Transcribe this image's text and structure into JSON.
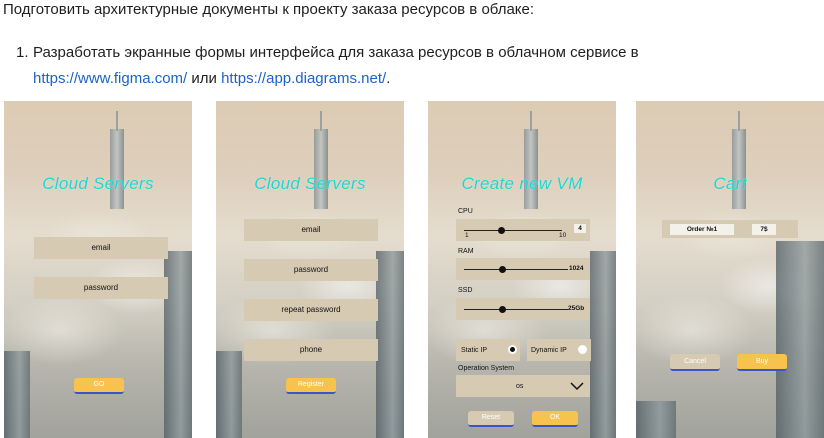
{
  "intro": "Подготовить архитектурные документы к проекту заказа ресурсов в облаке:",
  "task": {
    "number": "1.",
    "text_before": "Разработать экранные формы интерфейса для заказа ресурсов в облачном сервисе в",
    "link1": "https://www.figma.com/",
    "middle": " или ",
    "link2": "https://app.diagrams.net/",
    "end": "."
  },
  "screens": {
    "login": {
      "title": "Cloud Servers",
      "email": "email",
      "password": "password",
      "button": "GO"
    },
    "register": {
      "title": "Cloud Servers",
      "email": "email",
      "password": "password",
      "repeat_password": "repeat password",
      "phone": "phone",
      "button": "Register"
    },
    "create_vm": {
      "title": "Create new VM",
      "cpu_label": "CPU",
      "cpu_min": "1",
      "cpu_max": "10",
      "cpu_value": "4",
      "ram_label": "RAM",
      "ram_value": "1024",
      "ssd_label": "SSD",
      "ssd_value": "25Gb",
      "static_ip": "Static IP",
      "dynamic_ip": "Dynamic IP",
      "os_label": "Operation System",
      "os_value": "os",
      "reset": "Reset",
      "ok": "OK"
    },
    "cart": {
      "title": "Cart",
      "order": "Order №1",
      "price": "7$",
      "cancel": "Cancel",
      "buy": "Buy"
    }
  }
}
